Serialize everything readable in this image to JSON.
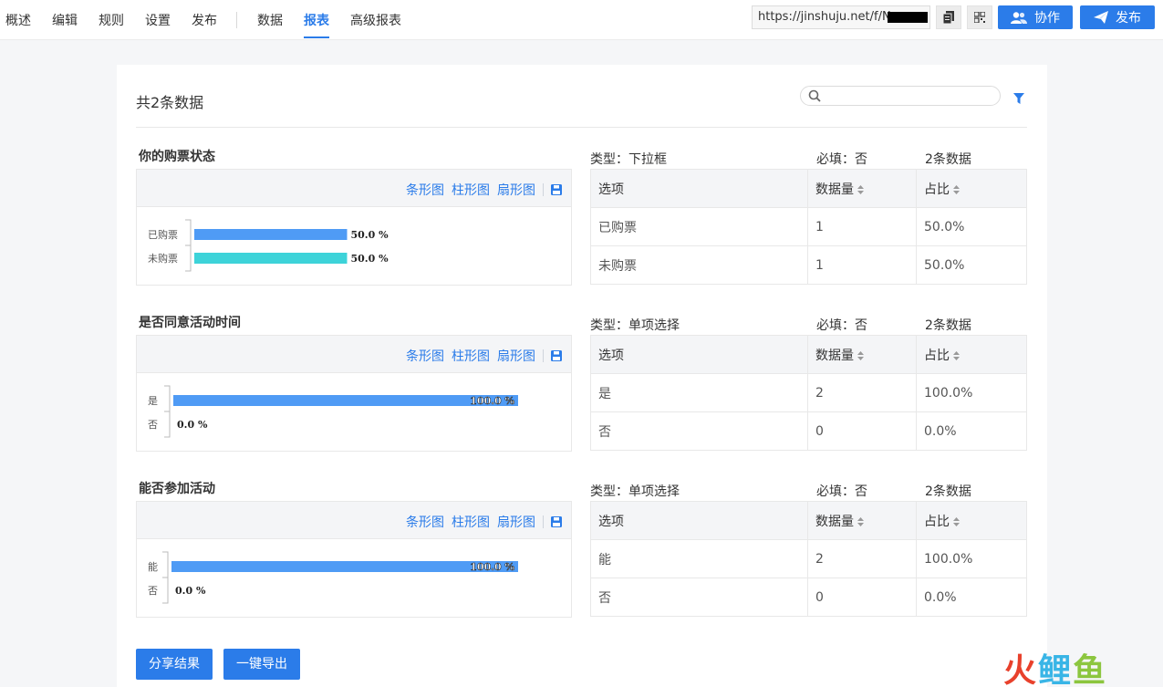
{
  "nav": {
    "items": [
      {
        "label": "概述",
        "active": false
      },
      {
        "label": "编辑",
        "active": false
      },
      {
        "label": "规则",
        "active": false
      },
      {
        "label": "设置",
        "active": false
      },
      {
        "label": "发布",
        "active": false
      }
    ],
    "items2": [
      {
        "label": "数据",
        "active": false
      },
      {
        "label": "报表",
        "active": true
      },
      {
        "label": "高级报表",
        "active": false
      }
    ]
  },
  "header": {
    "url": "https://jinshuju.net/f/N",
    "collab_label": "协作",
    "publish_label": "发布",
    "accent": "#2b7ce9"
  },
  "main": {
    "title": "共2条数据",
    "search_placeholder": ""
  },
  "chart_links": {
    "bar_h": "条形图",
    "bar_v": "柱形图",
    "pie": "扇形图"
  },
  "table_headers": {
    "option": "选项",
    "count": "数据量",
    "ratio": "占比"
  },
  "sections": [
    {
      "title": "你的购票状态",
      "type_text": "类型：下拉框",
      "required_text": "必填：否",
      "count_text": "2条数据",
      "rows": [
        {
          "option": "已购票",
          "count": "1",
          "ratio": "50.0%"
        },
        {
          "option": "未购票",
          "count": "1",
          "ratio": "50.0%"
        }
      ]
    },
    {
      "title": "是否同意活动时间",
      "type_text": "类型：单项选择",
      "required_text": "必填：否",
      "count_text": "2条数据",
      "rows": [
        {
          "option": "是",
          "count": "2",
          "ratio": "100.0%"
        },
        {
          "option": "否",
          "count": "0",
          "ratio": "0.0%"
        }
      ]
    },
    {
      "title": "能否参加活动",
      "type_text": "类型：单项选择",
      "required_text": "必填：否",
      "count_text": "2条数据",
      "rows": [
        {
          "option": "能",
          "count": "2",
          "ratio": "100.0%"
        },
        {
          "option": "否",
          "count": "0",
          "ratio": "0.0%"
        }
      ]
    }
  ],
  "chart_data": [
    {
      "type": "bar",
      "orientation": "horizontal",
      "categories": [
        "已购票",
        "未购票"
      ],
      "values": [
        50.0,
        50.0
      ],
      "labels": [
        "50.0 %",
        "50.0 %"
      ],
      "colors": [
        "#4f9bf5",
        "#3dd3d9"
      ],
      "xlim": [
        0,
        100
      ]
    },
    {
      "type": "bar",
      "orientation": "horizontal",
      "categories": [
        "是",
        "否"
      ],
      "values": [
        100.0,
        0.0
      ],
      "labels": [
        "100.0 %",
        "0.0 %"
      ],
      "colors": [
        "#4f9bf5",
        "#4f9bf5"
      ],
      "xlim": [
        0,
        100
      ]
    },
    {
      "type": "bar",
      "orientation": "horizontal",
      "categories": [
        "能",
        "否"
      ],
      "values": [
        100.0,
        0.0
      ],
      "labels": [
        "100.0 %",
        "0.0 %"
      ],
      "colors": [
        "#4f9bf5",
        "#4f9bf5"
      ],
      "xlim": [
        0,
        100
      ]
    }
  ],
  "footer": {
    "share_label": "分享结果",
    "export_label": "一键导出"
  },
  "watermark": {
    "c1": "火",
    "c2": "鲤",
    "c3": "鱼"
  }
}
